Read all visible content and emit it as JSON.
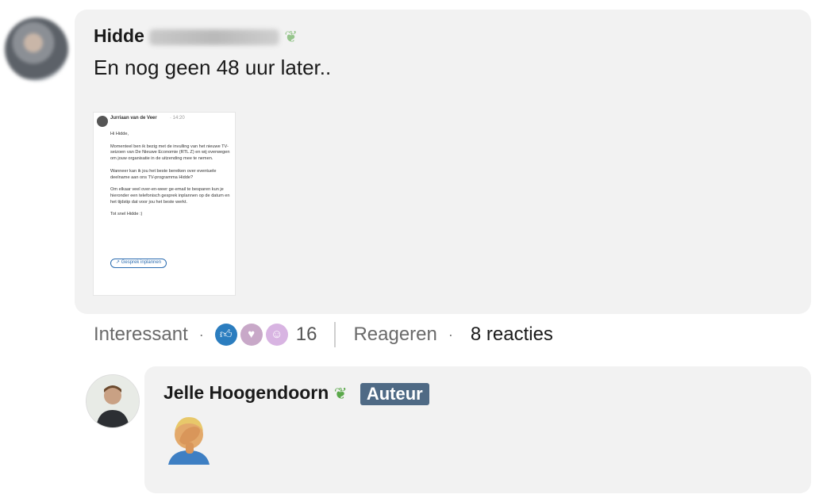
{
  "comment": {
    "author_first": "Hidde",
    "message": "En nog geen 48 uur later..",
    "attachment": {
      "sender": "Jurriaan van de Veer",
      "time": "· 14:20",
      "body": "Hi Hidde,\n\nMomenteel ben ik bezig met de invulling van het nieuwe TV-seizoen van De Nieuwe Economie (RTL Z) en wij overwegen om jouw organisatie in de uitzending mee te nemen.\n\nWanneer kan ik jou het beste bereiken over eventuele deelname aan ons TV-programma Hidde?\n\nOm elkaar veel over-en-weer ge-email te besparen kun je hieronder een telefonisch gesprek inplannen op de datum en het tijdstip dat voor jou het beste werkt.\n\nTot snel Hidde :)",
      "button": "Gesprek inplannen"
    }
  },
  "actions": {
    "like_label": "Interessant",
    "reaction_count": "16",
    "reply_label": "Reageren",
    "replies_count": "8 reacties",
    "reaction_icons": [
      "like-icon",
      "support-icon",
      "insightful-icon"
    ]
  },
  "reply": {
    "author": "Jelle Hoogendoorn",
    "badge": "Auteur",
    "emoji_name": "facepalm-emoji"
  },
  "colors": {
    "bubble": "#f2f2f2",
    "badge": "#4f6a85",
    "link": "#2b6cb0"
  }
}
